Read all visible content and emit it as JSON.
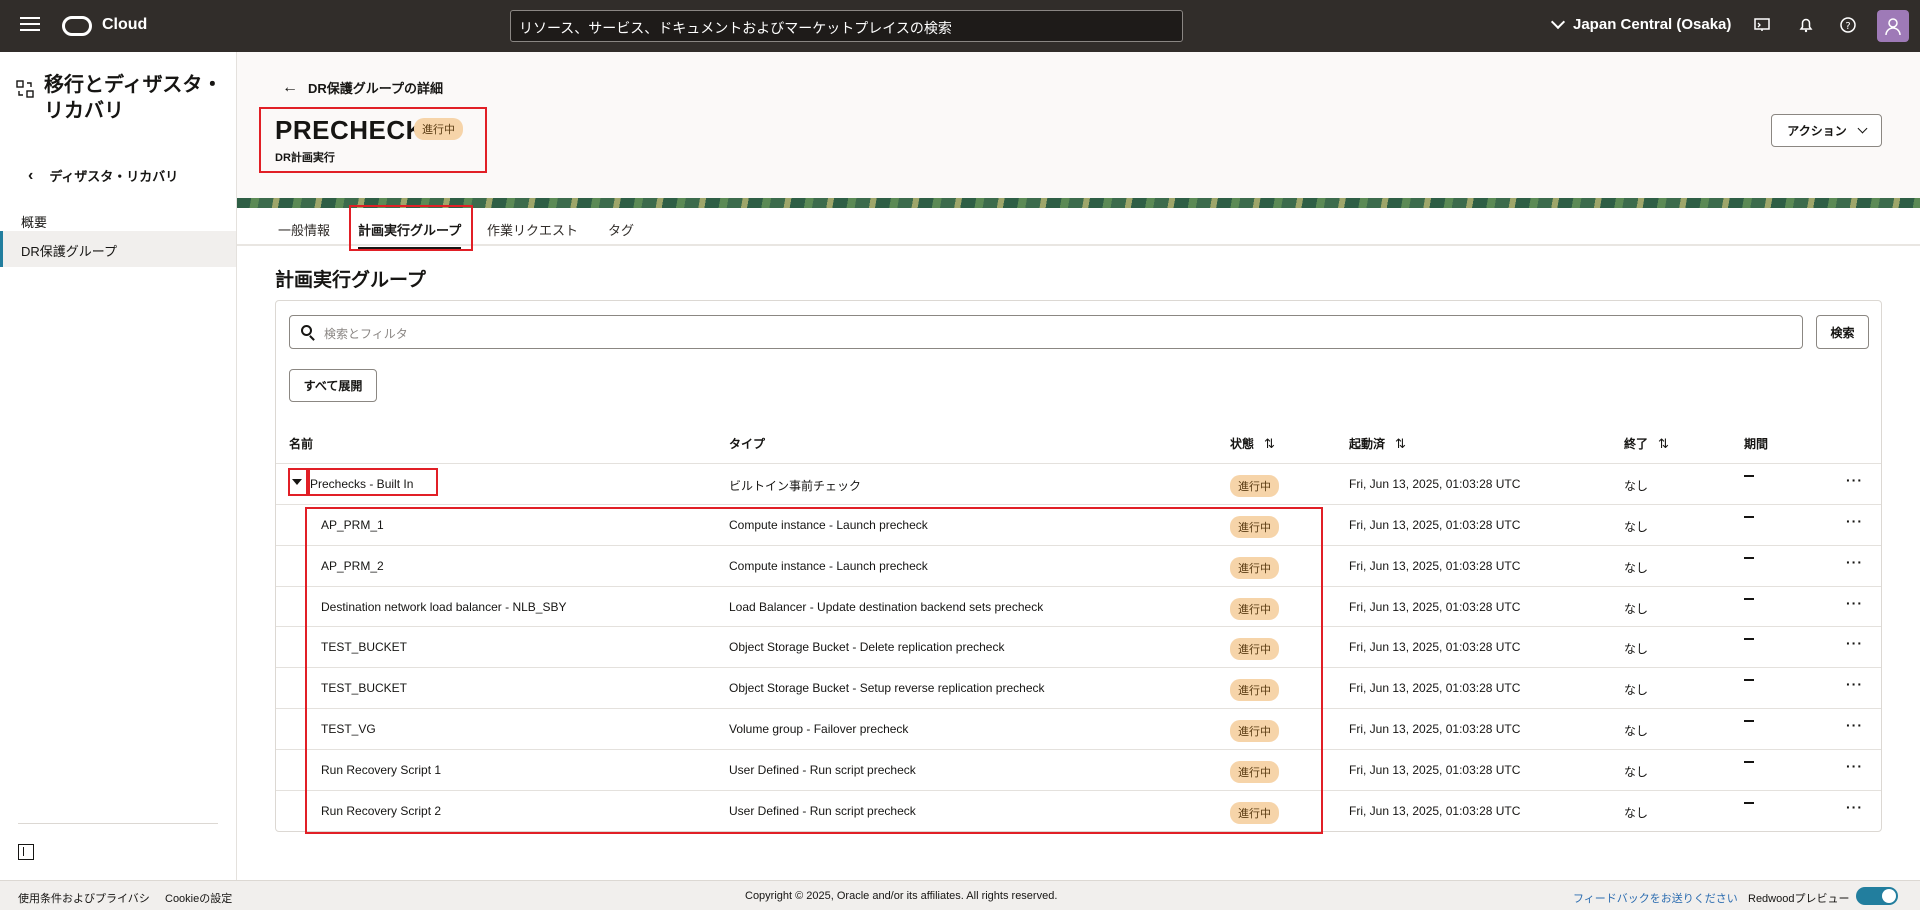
{
  "topbar": {
    "brand": "Cloud",
    "search_placeholder": "リソース、サービス、ドキュメントおよびマーケットプレイスの検索",
    "region": "Japan Central (Osaka)"
  },
  "sidebar": {
    "title": "移行とディザスタ・リカバリ",
    "back_label": "ディザスタ・リカバリ",
    "items": [
      {
        "label": "概要"
      },
      {
        "label": "DR保護グループ"
      }
    ]
  },
  "header": {
    "breadcrumb": "DR保護グループの詳細",
    "title": "PRECHECK",
    "status": "進行中",
    "subtitle": "DR計画実行",
    "action_label": "アクション"
  },
  "tabs": [
    {
      "label": "一般情報"
    },
    {
      "label": "計画実行グループ"
    },
    {
      "label": "作業リクエスト"
    },
    {
      "label": "タグ"
    }
  ],
  "section": {
    "title": "計画実行グループ",
    "filter_placeholder": "検索とフィルタ",
    "search_button": "検索",
    "expand_button": "すべて展開"
  },
  "table": {
    "columns": [
      "名前",
      "タイプ",
      "状態",
      "起動済",
      "終了",
      "期間"
    ],
    "group": {
      "name": "Prechecks - Built In",
      "type": "ビルトイン事前チェック",
      "status": "進行中",
      "started": "Fri, Jun 13, 2025, 01:03:28 UTC",
      "ended": "なし"
    },
    "rows": [
      {
        "name": "AP_PRM_1",
        "type": "Compute instance - Launch precheck",
        "status": "進行中",
        "started": "Fri, Jun 13, 2025, 01:03:28 UTC",
        "ended": "なし"
      },
      {
        "name": "AP_PRM_2",
        "type": "Compute instance - Launch precheck",
        "status": "進行中",
        "started": "Fri, Jun 13, 2025, 01:03:28 UTC",
        "ended": "なし"
      },
      {
        "name": "Destination network load balancer - NLB_SBY",
        "type": "Load Balancer - Update destination backend sets precheck",
        "status": "進行中",
        "started": "Fri, Jun 13, 2025, 01:03:28 UTC",
        "ended": "なし"
      },
      {
        "name": "TEST_BUCKET",
        "type": "Object Storage Bucket - Delete replication precheck",
        "status": "進行中",
        "started": "Fri, Jun 13, 2025, 01:03:28 UTC",
        "ended": "なし"
      },
      {
        "name": "TEST_BUCKET",
        "type": "Object Storage Bucket - Setup reverse replication precheck",
        "status": "進行中",
        "started": "Fri, Jun 13, 2025, 01:03:28 UTC",
        "ended": "なし"
      },
      {
        "name": "TEST_VG",
        "type": "Volume group - Failover precheck",
        "status": "進行中",
        "started": "Fri, Jun 13, 2025, 01:03:28 UTC",
        "ended": "なし"
      },
      {
        "name": "Run Recovery Script 1",
        "type": "User Defined - Run script precheck",
        "status": "進行中",
        "started": "Fri, Jun 13, 2025, 01:03:28 UTC",
        "ended": "なし"
      },
      {
        "name": "Run Recovery Script 2",
        "type": "User Defined - Run script precheck",
        "status": "進行中",
        "started": "Fri, Jun 13, 2025, 01:03:28 UTC",
        "ended": "なし"
      }
    ]
  },
  "footer": {
    "terms": "使用条件およびプライバシ",
    "cookie": "Cookieの設定",
    "copyright": "Copyright © 2025, Oracle and/or its affiliates. All rights reserved.",
    "feedback": "フィードバックをお送りください",
    "redwood": "Redwoodプレビュー"
  },
  "colors": {
    "topbar": "#312d2a",
    "badge": "#f6d4a9",
    "highlight": "#e11f26",
    "accent": "#227e9e"
  }
}
